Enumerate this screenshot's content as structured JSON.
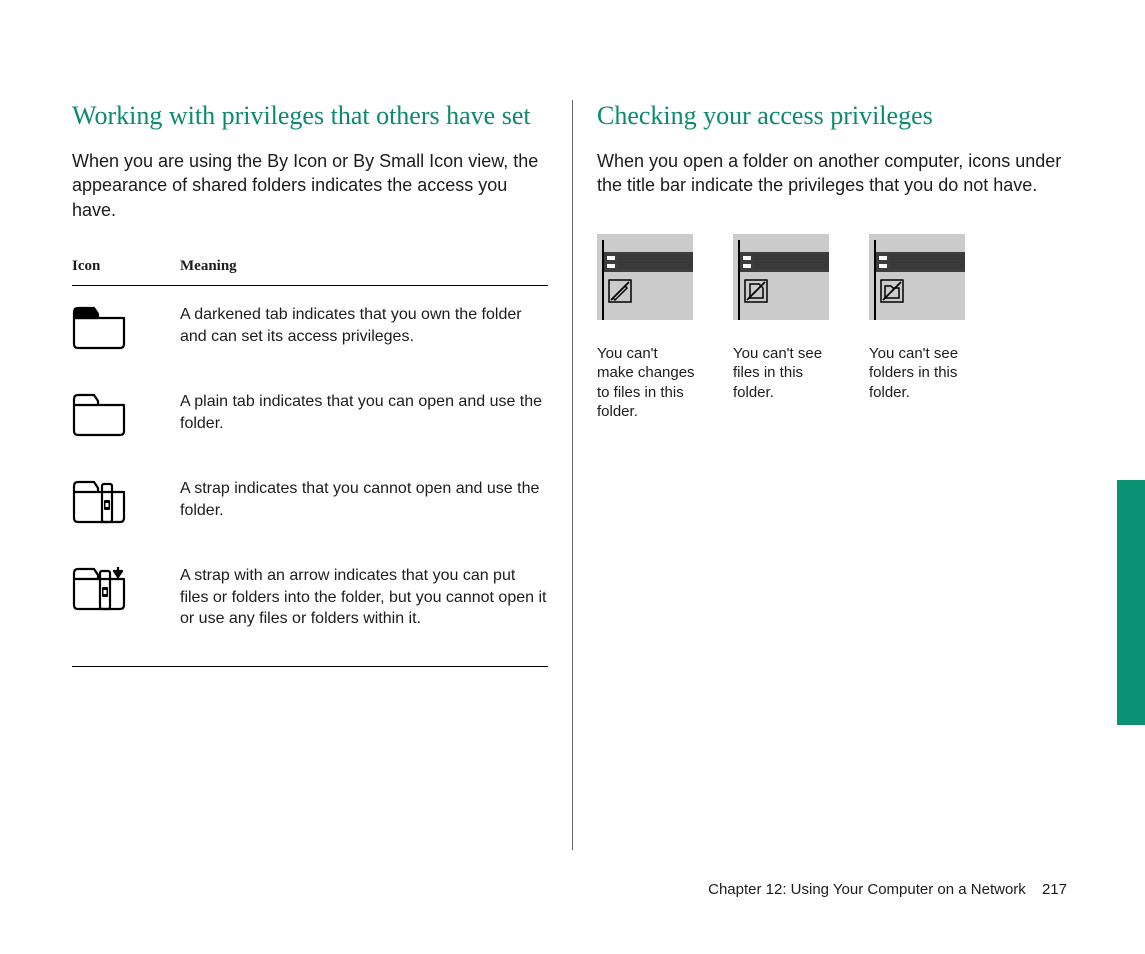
{
  "left": {
    "heading": "Working with privileges that others have set",
    "intro": "When you are using the By Icon or By Small Icon view, the appearance of shared folders indicates the access you have.",
    "table": {
      "headers": {
        "icon": "Icon",
        "meaning": "Meaning"
      },
      "rows": [
        {
          "icon": "folder-dark-tab",
          "meaning": "A darkened tab indicates that you own the folder and can set its access privileges."
        },
        {
          "icon": "folder-plain-tab",
          "meaning": "A plain tab indicates that you can open and use the folder."
        },
        {
          "icon": "folder-strap",
          "meaning": "A strap indicates that you cannot open and use the folder."
        },
        {
          "icon": "folder-strap-arrow",
          "meaning": "A strap with an arrow indicates that you can put files or folders into the folder, but you cannot open it or use any files or folders within it."
        }
      ]
    }
  },
  "right": {
    "heading": "Checking your access privileges",
    "intro": "When you open a folder on another computer, icons under the title bar indicate the privileges that you do not have.",
    "items": [
      {
        "icon": "no-changes",
        "caption": "You can't make changes to files in this folder."
      },
      {
        "icon": "no-files",
        "caption": "You can't see files in this folder."
      },
      {
        "icon": "no-folders",
        "caption": "You can't see folders in this folder."
      }
    ]
  },
  "footer": {
    "chapter": "Chapter 12: Using Your Computer on a Network",
    "page": "217"
  }
}
